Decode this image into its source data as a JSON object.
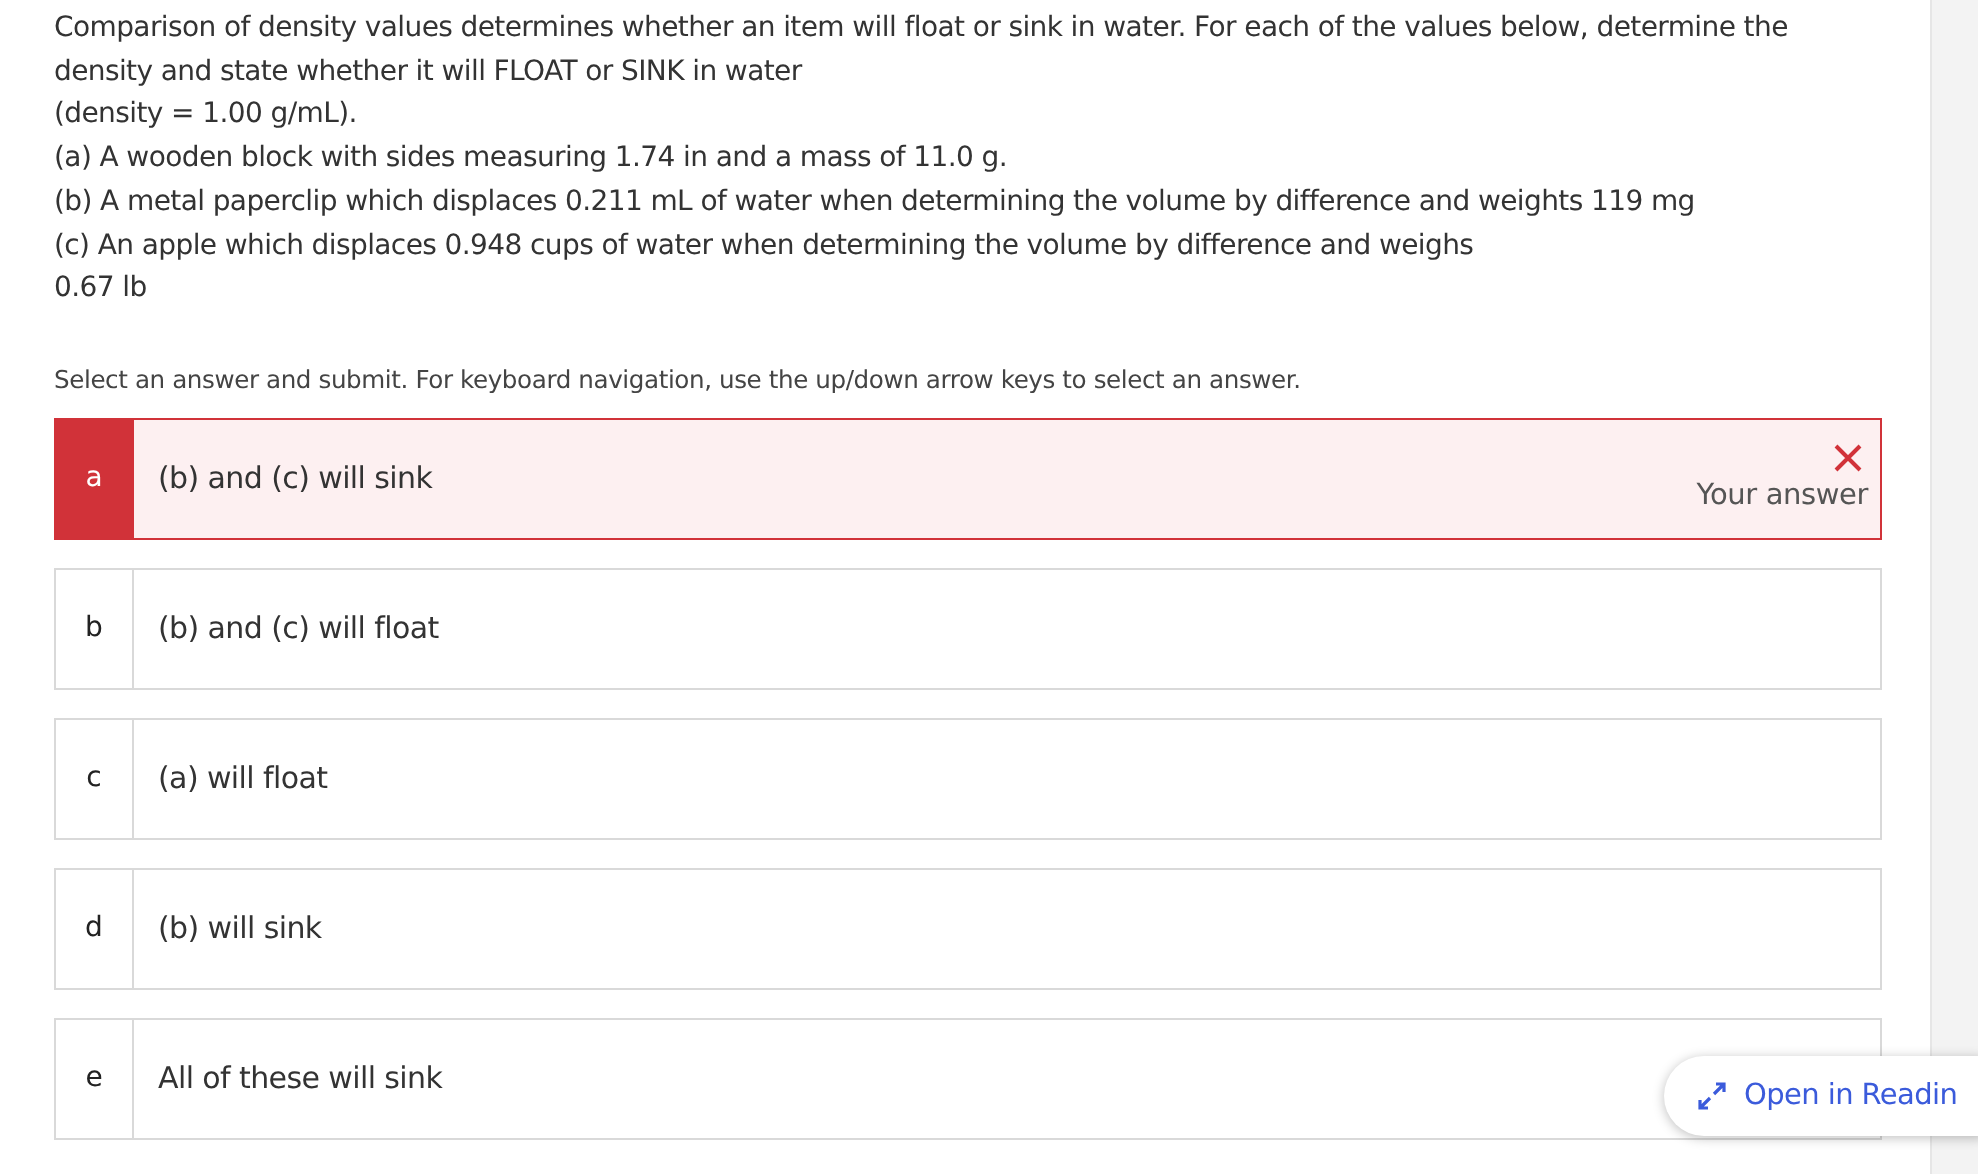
{
  "question": {
    "lines": [
      "Comparison of density values determines whether an item will float or sink in water. For each of the values below, determine the density and state whether it will FLOAT or SINK in water",
      "(density = 1.00 g/mL).",
      "(a) A wooden block with sides measuring 1.74 in and a mass of 11.0 g.",
      "(b) A metal paperclip which displaces 0.211 mL of water when determining the volume by difference and weights 119 mg",
      "(c) An apple which displaces 0.948 cups of water when determining the volume by difference and weighs",
      "0.67 lb"
    ]
  },
  "instruction": "Select an answer and submit. For keyboard navigation, use the up/down arrow keys to select an answer.",
  "options": [
    {
      "letter": "a",
      "text": "(b) and (c) will sink",
      "selected": true,
      "incorrect": true,
      "note": "Your answer"
    },
    {
      "letter": "b",
      "text": "(b) and (c) will float",
      "selected": false,
      "incorrect": false
    },
    {
      "letter": "c",
      "text": "(a) will float",
      "selected": false,
      "incorrect": false
    },
    {
      "letter": "d",
      "text": "(b) will sink",
      "selected": false,
      "incorrect": false
    },
    {
      "letter": "e",
      "text": "All of these will sink",
      "selected": false,
      "incorrect": false
    }
  ],
  "reading_button": {
    "label": "Open in Readin"
  }
}
